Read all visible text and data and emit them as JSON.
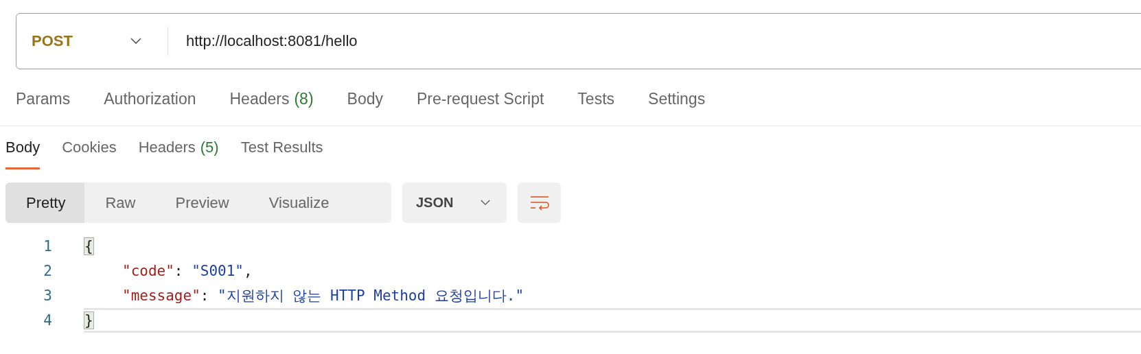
{
  "request": {
    "method": "POST",
    "url": "http://localhost:8081/hello"
  },
  "request_tabs": [
    {
      "label": "Params",
      "selected": false
    },
    {
      "label": "Authorization",
      "selected": false
    },
    {
      "label": "Headers",
      "count": "(8)",
      "selected": false
    },
    {
      "label": "Body",
      "selected": false
    },
    {
      "label": "Pre-request Script",
      "selected": false
    },
    {
      "label": "Tests",
      "selected": false
    },
    {
      "label": "Settings",
      "selected": false
    }
  ],
  "response_tabs": [
    {
      "label": "Body",
      "selected": true
    },
    {
      "label": "Cookies",
      "selected": false
    },
    {
      "label": "Headers",
      "count": "(5)",
      "selected": false
    },
    {
      "label": "Test Results",
      "selected": false
    }
  ],
  "view_modes": [
    {
      "label": "Pretty",
      "selected": true
    },
    {
      "label": "Raw",
      "selected": false
    },
    {
      "label": "Preview",
      "selected": false
    },
    {
      "label": "Visualize",
      "selected": false
    }
  ],
  "format": "JSON",
  "code_lines": [
    {
      "number": "1",
      "active": false,
      "indent": false,
      "tokens": [
        {
          "kind": "bracket",
          "text": "{"
        }
      ]
    },
    {
      "number": "2",
      "active": false,
      "indent": true,
      "tokens": [
        {
          "kind": "key",
          "text": "\"code\""
        },
        {
          "kind": "punct",
          "text": ": "
        },
        {
          "kind": "string",
          "text": "\"S001\""
        },
        {
          "kind": "punct",
          "text": ","
        }
      ]
    },
    {
      "number": "3",
      "active": false,
      "indent": true,
      "tokens": [
        {
          "kind": "key",
          "text": "\"message\""
        },
        {
          "kind": "punct",
          "text": ": "
        },
        {
          "kind": "string",
          "text": "\"지원하지 않는 HTTP Method 요청입니다.\""
        }
      ]
    },
    {
      "number": "4",
      "active": true,
      "indent": false,
      "tokens": [
        {
          "kind": "bracket",
          "text": "}"
        }
      ]
    }
  ]
}
